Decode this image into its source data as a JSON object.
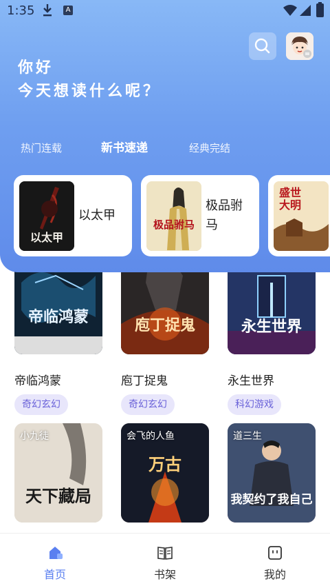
{
  "status_bar": {
    "time": "1:35"
  },
  "header": {
    "greeting_line1": "你好",
    "greeting_line2": "今天想读什么呢？"
  },
  "tabs": [
    {
      "label": "热门连载",
      "active": false
    },
    {
      "label": "新书速递",
      "active": true
    },
    {
      "label": "经典完结",
      "active": false
    }
  ],
  "featured": [
    {
      "title": "以太甲",
      "cover_text": "以太甲"
    },
    {
      "title": "极品驸马",
      "cover_text": "极品驸马"
    },
    {
      "title": "",
      "cover_text": "盛世大明"
    }
  ],
  "books": [
    {
      "title": "帝临鸿蒙",
      "tag": "奇幻玄幻",
      "cover_text": "帝临鸿蒙",
      "author": ""
    },
    {
      "title": "庖丁捉鬼",
      "tag": "奇幻玄幻",
      "cover_text": "庖丁捉鬼",
      "author": ""
    },
    {
      "title": "永生世界",
      "tag": "科幻游戏",
      "cover_text": "永生世界",
      "author": ""
    },
    {
      "title": "",
      "tag": "",
      "cover_text": "天下藏局",
      "author": "小九徒"
    },
    {
      "title": "",
      "tag": "",
      "cover_text": "万古",
      "author": "会飞的人鱼"
    },
    {
      "title": "",
      "tag": "",
      "cover_text": "我契约了我自己",
      "author": "道三生"
    }
  ],
  "bottom_nav": [
    {
      "label": "首页",
      "icon": "home-icon",
      "active": true
    },
    {
      "label": "书架",
      "icon": "bookshelf-icon",
      "active": false
    },
    {
      "label": "我的",
      "icon": "profile-icon",
      "active": false
    }
  ],
  "colors": {
    "accent": "#5a7ff0",
    "tag_bg": "#e8e6fb",
    "tag_text": "#6b63d9"
  }
}
